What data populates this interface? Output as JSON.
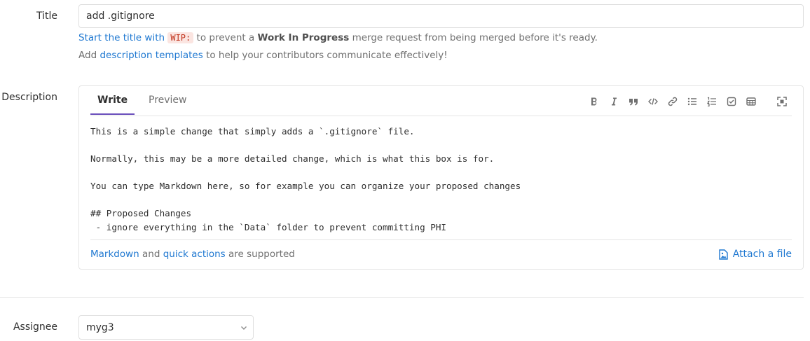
{
  "title": {
    "label": "Title",
    "value": "add .gitignore",
    "hint_start": "Start the title with",
    "hint_code": "WIP:",
    "hint_mid": "to prevent a",
    "hint_bold": "Work In Progress",
    "hint_end": "merge request from being merged before it's ready.",
    "templates_prefix": "Add",
    "templates_link": "description templates",
    "templates_suffix": "to help your contributors communicate effectively!"
  },
  "description": {
    "label": "Description",
    "tabs": {
      "write": "Write",
      "preview": "Preview"
    },
    "toolbar_icons": [
      "bold-icon",
      "italic-icon",
      "quote-icon",
      "code-icon",
      "link-icon",
      "bullet-list-icon",
      "numbered-list-icon",
      "task-list-icon",
      "table-icon",
      "fullscreen-icon"
    ],
    "text": "This is a simple change that simply adds a `.gitignore` file.\n\nNormally, this may be a more detailed change, which is what this box is for.\n\nYou can type Markdown here, so for example you can organize your proposed changes\n\n## Proposed Changes\n - ignore everything in the `Data` folder to prevent committing PHI",
    "footer": {
      "markdown_link": "Markdown",
      "and": "and",
      "quick_actions_link": "quick actions",
      "supported": "are supported",
      "attach": "Attach a file"
    }
  },
  "assignee": {
    "label": "Assignee",
    "value": "myg3"
  },
  "colors": {
    "link": "#1f78d1",
    "active_tab": "#6b4fbb",
    "wip_bg": "#fbe5e1",
    "wip_text": "#c0341d"
  }
}
